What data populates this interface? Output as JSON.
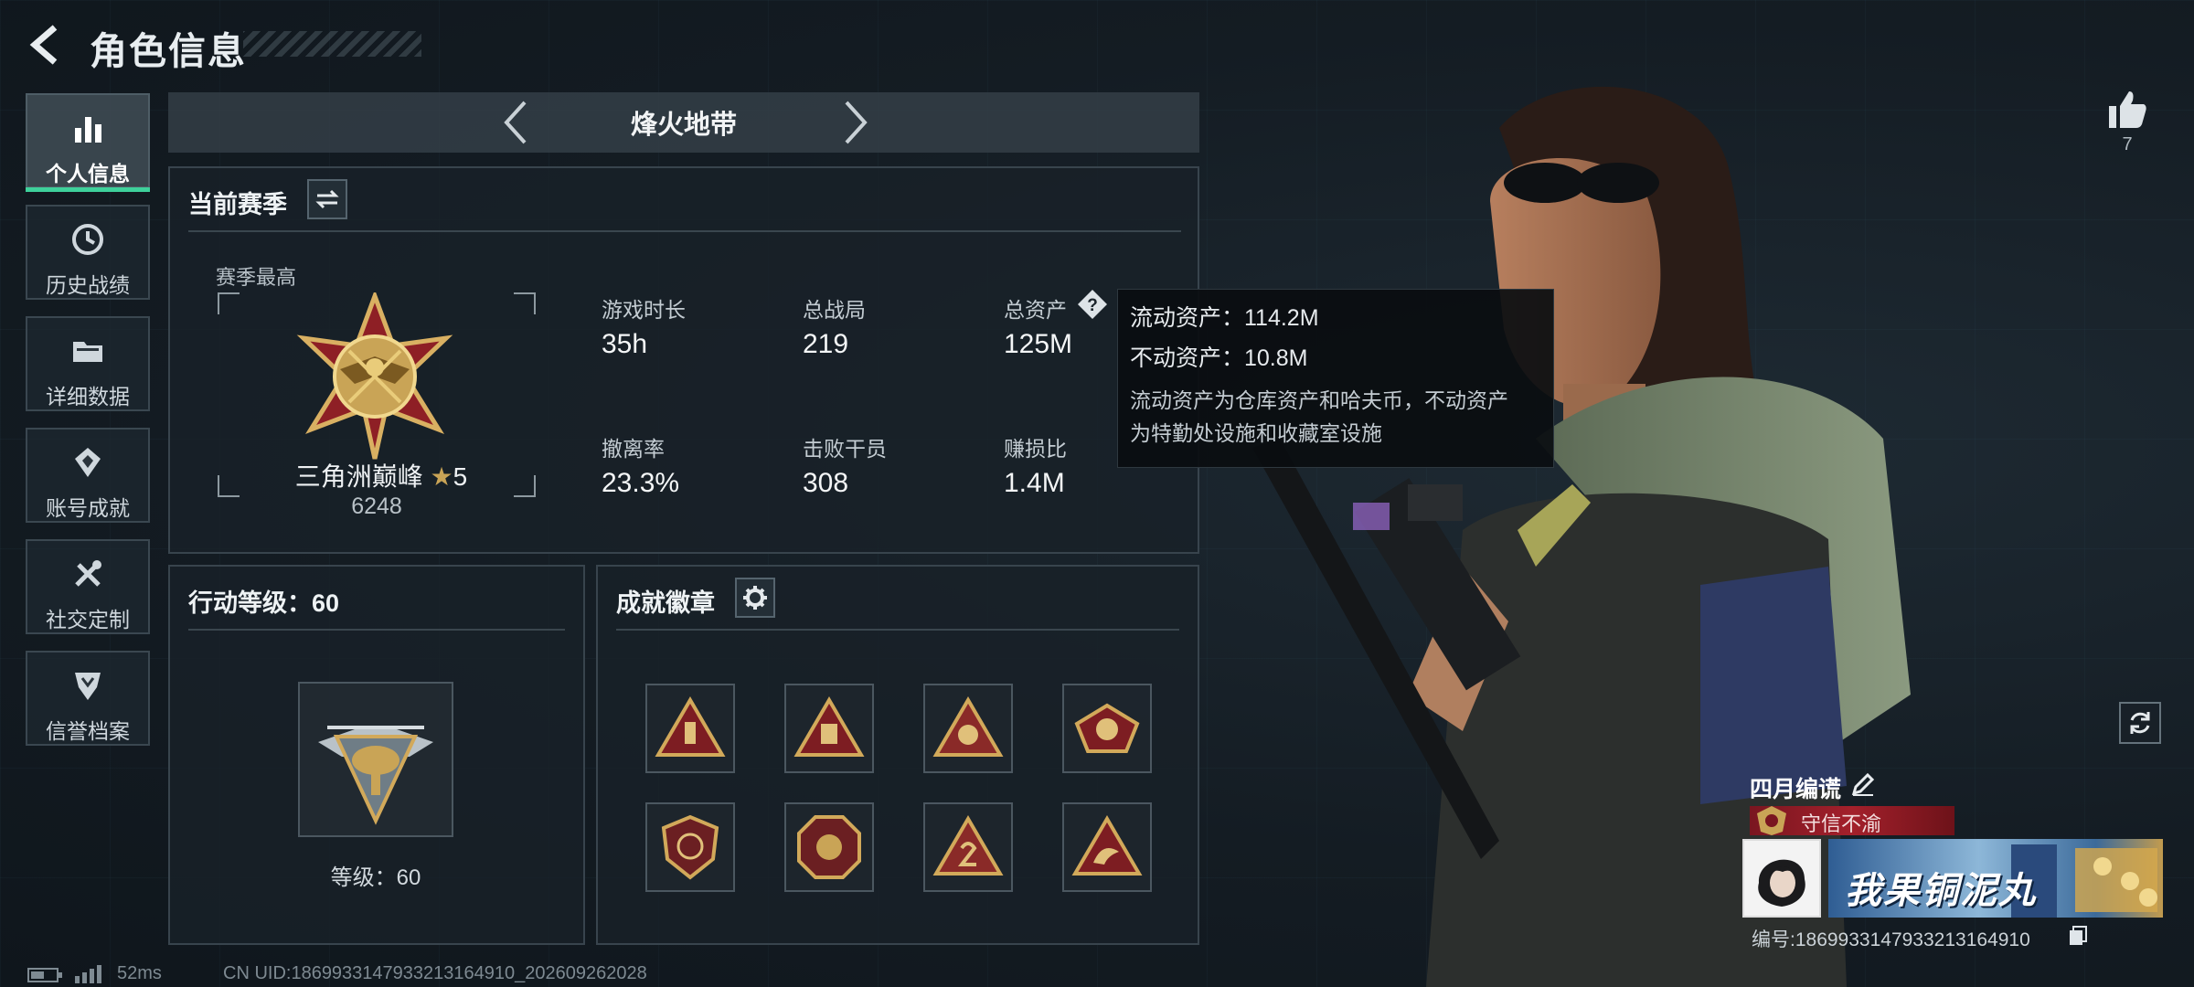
{
  "header": {
    "title": "角色信息"
  },
  "nav": {
    "items": [
      {
        "label": "个人信息",
        "icon": "bar-chart-icon",
        "active": true
      },
      {
        "label": "历史战绩",
        "icon": "clock-icon"
      },
      {
        "label": "详细数据",
        "icon": "folder-icon"
      },
      {
        "label": "账号成就",
        "icon": "achievement-icon"
      },
      {
        "label": "社交定制",
        "icon": "tools-icon"
      },
      {
        "label": "信誉档案",
        "icon": "credit-shield-icon"
      }
    ]
  },
  "mode": {
    "title": "烽火地带"
  },
  "season": {
    "title": "当前赛季",
    "highest_label": "赛季最高",
    "rank_name": "三角洲巅峰",
    "rank_stars": "5",
    "rank_score": "6248",
    "stats": [
      {
        "label": "游戏时长",
        "value": "35h"
      },
      {
        "label": "总战局",
        "value": "219"
      },
      {
        "label": "总资产",
        "value": "125M"
      },
      {
        "label": "撤离率",
        "value": "23.3%"
      },
      {
        "label": "击败干员",
        "value": "308"
      },
      {
        "label": "赚损比",
        "value": "1.4M"
      }
    ],
    "help_icon_text": "?"
  },
  "tooltip": {
    "liquid": "流动资产：114.2M",
    "fixed": "不动资产：10.8M",
    "desc_line1": "流动资产为仓库资产和哈夫币，不动资产",
    "desc_line2": "为特勤处设施和收藏室设施"
  },
  "level": {
    "title": "行动等级：60",
    "caption": "等级：60"
  },
  "badges": {
    "title": "成就徽章",
    "count": 8
  },
  "profile": {
    "like_count": "7",
    "player_name": "四月编谎",
    "honor": "守信不渝",
    "card_text": "我果铜泥丸",
    "uid_line": "编号:1869933147933213164910"
  },
  "footer": {
    "ping": "52ms",
    "uid": "CN UID:1869933147933213164910_202609262028"
  },
  "colors": {
    "accent": "#3ed19b",
    "gold": "#c9a456",
    "honor_red": "#a3202b"
  }
}
